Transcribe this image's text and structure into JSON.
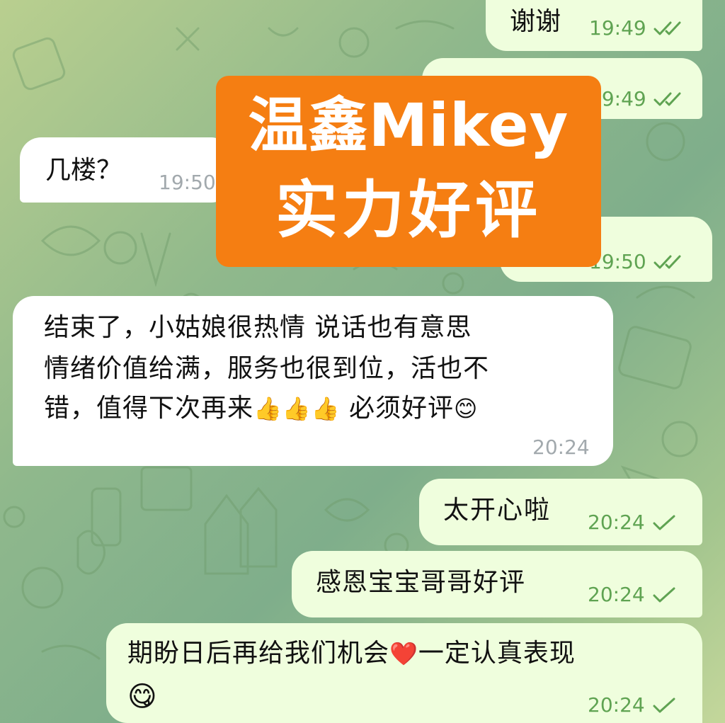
{
  "messages": [
    {
      "id": "m1",
      "direction": "out",
      "text": "谢谢",
      "time": "19:49",
      "status": "read"
    },
    {
      "id": "m2",
      "direction": "out",
      "text": "",
      "time": "19:49",
      "status": "read"
    },
    {
      "id": "m3",
      "direction": "in",
      "text": "几楼？",
      "time": "19:50"
    },
    {
      "id": "m4",
      "direction": "out",
      "text": "",
      "time": "19:50",
      "status": "read"
    },
    {
      "id": "m5",
      "direction": "in",
      "lines": [
        "结束了，小姑娘很热情 说话也有意思",
        "情绪价值给满，服务也很到位，活也不",
        "错，值得下次再来",
        "必须好评"
      ],
      "emojis": [
        "👍",
        "😊"
      ],
      "time": "20:24"
    },
    {
      "id": "m6",
      "direction": "out",
      "text": "太开心啦",
      "time": "20:24",
      "status": "sent"
    },
    {
      "id": "m7",
      "direction": "out",
      "text": "感恩宝宝哥哥好评",
      "time": "20:24",
      "status": "sent"
    },
    {
      "id": "m8",
      "direction": "out",
      "line1_a": "期盼日后再给我们机会",
      "line1_b": "一定认真表现",
      "emojis": [
        "❤️",
        "😋"
      ],
      "time": "20:24",
      "status": "sent"
    }
  ],
  "overlay": {
    "line1": "温鑫Mikey",
    "line2": "实力好评"
  },
  "colors": {
    "outgoing_bubble": "#effedd",
    "incoming_bubble": "#ffffff",
    "overlay": "#f57e12",
    "check": "#5fa352"
  },
  "icons": {
    "read": "double-check-icon",
    "sent": "single-check-icon"
  }
}
